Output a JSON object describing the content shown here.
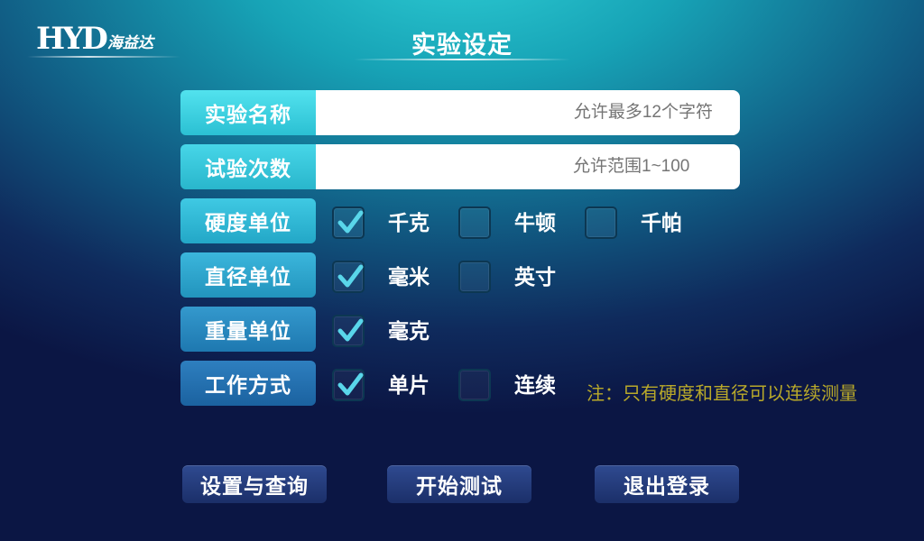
{
  "logo": {
    "mark": "HYD",
    "cn": "海益达"
  },
  "page_title": "实验设定",
  "experiment_name": {
    "label": "实验名称",
    "placeholder": "允许最多12个字符"
  },
  "test_count": {
    "label": "试验次数",
    "placeholder": "允许范围1~100"
  },
  "hardness_unit": {
    "label": "硬度单位",
    "options": [
      {
        "label": "千克",
        "checked": true
      },
      {
        "label": "牛顿",
        "checked": false
      },
      {
        "label": "千帕",
        "checked": false
      }
    ]
  },
  "diameter_unit": {
    "label": "直径单位",
    "options": [
      {
        "label": "毫米",
        "checked": true
      },
      {
        "label": "英寸",
        "checked": false
      }
    ]
  },
  "weight_unit": {
    "label": "重量单位",
    "options": [
      {
        "label": "毫克",
        "checked": true
      }
    ]
  },
  "work_mode": {
    "label": "工作方式",
    "options": [
      {
        "label": "单片",
        "checked": true
      },
      {
        "label": "连续",
        "checked": false
      }
    ],
    "note": "注：只有硬度和直径可以连续测量"
  },
  "buttons": {
    "settings_query": "设置与查询",
    "start_test": "开始测试",
    "logout": "退出登录"
  },
  "colors": {
    "check_mark": "#59d6ea",
    "note_text": "#b9a92a",
    "button_bg": "#24397a"
  }
}
